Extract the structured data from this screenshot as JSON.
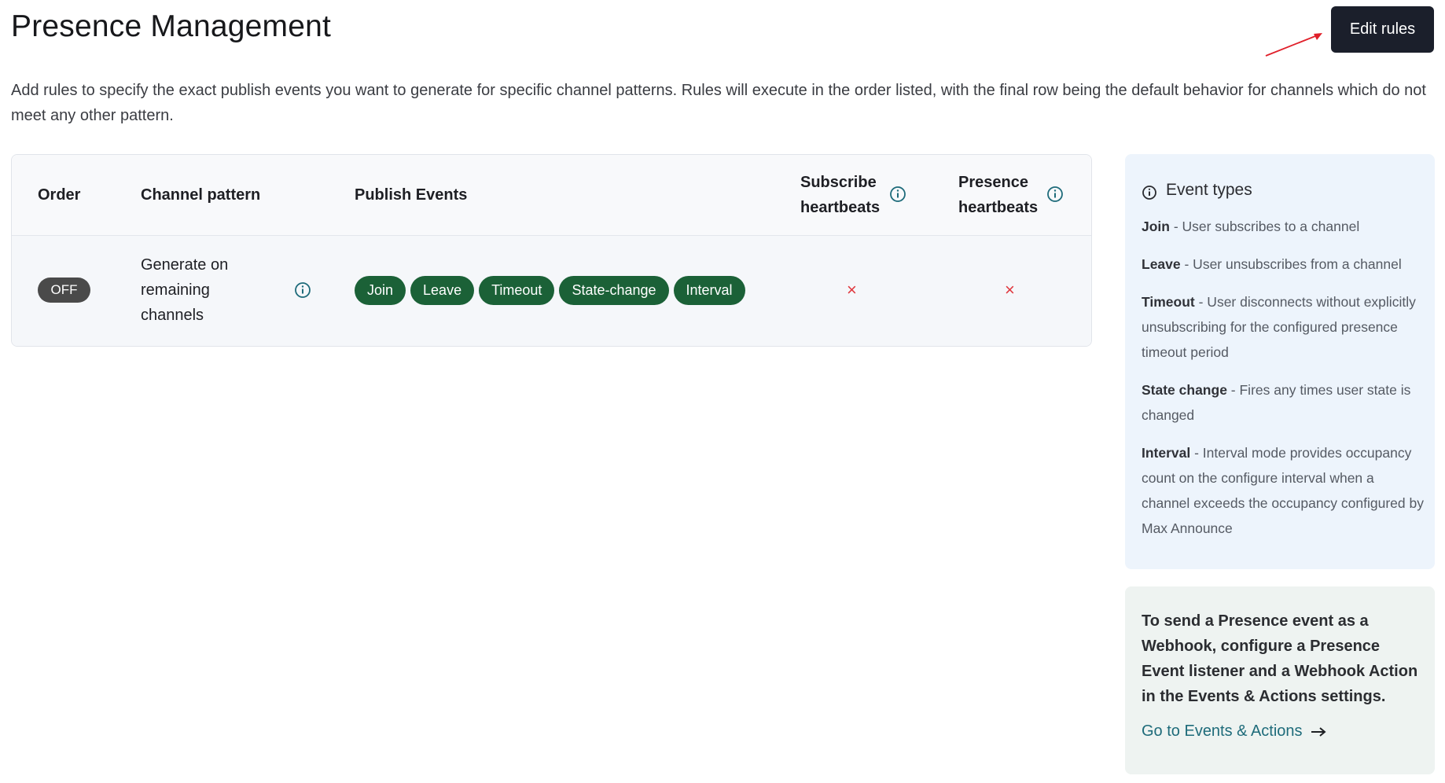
{
  "page": {
    "title": "Presence Management",
    "edit_button_label": "Edit rules",
    "description": "Add rules to specify the exact publish events you want to generate for specific channel patterns. Rules will execute in the order listed, with the final row being the default behavior for channels which do not meet any other pattern."
  },
  "table": {
    "headers": {
      "order": "Order",
      "channel_pattern": "Channel pattern",
      "publish_events": "Publish Events",
      "subscribe_heartbeats": "Subscribe heartbeats",
      "presence_heartbeats": "Presence heartbeats"
    },
    "rows": [
      {
        "order_badge": "OFF",
        "channel_pattern": "Generate on remaining channels",
        "events": [
          "Join",
          "Leave",
          "Timeout",
          "State-change",
          "Interval"
        ],
        "subscribe_heartbeats": "×",
        "presence_heartbeats": "×"
      }
    ]
  },
  "event_types": {
    "title": "Event types",
    "items": [
      {
        "name": "Join",
        "desc": " - User subscribes to a channel"
      },
      {
        "name": "Leave",
        "desc": " - User unsubscribes from a channel"
      },
      {
        "name": "Timeout",
        "desc": " - User disconnects without explicitly unsubscribing for the configured presence timeout period"
      },
      {
        "name": "State change",
        "desc": " - Fires any times user state is changed"
      },
      {
        "name": "Interval",
        "desc": " - Interval mode provides occupancy count on the configure interval when a channel exceeds the occupancy configured by Max Announce"
      }
    ]
  },
  "webhook": {
    "text": "To send a Presence event as a Webhook, configure a Presence Event listener and a Webhook Action in the Events & Actions settings.",
    "link_label": "Go to Events & Actions"
  },
  "colors": {
    "button_bg": "#1b1f2b",
    "chip_green": "#1b6137",
    "cross_red": "#e0383e",
    "link_teal": "#1e6b7a",
    "annotation_red": "#e0202a"
  },
  "icons": [
    "info-icon",
    "close-icon",
    "arrow-right-icon"
  ]
}
